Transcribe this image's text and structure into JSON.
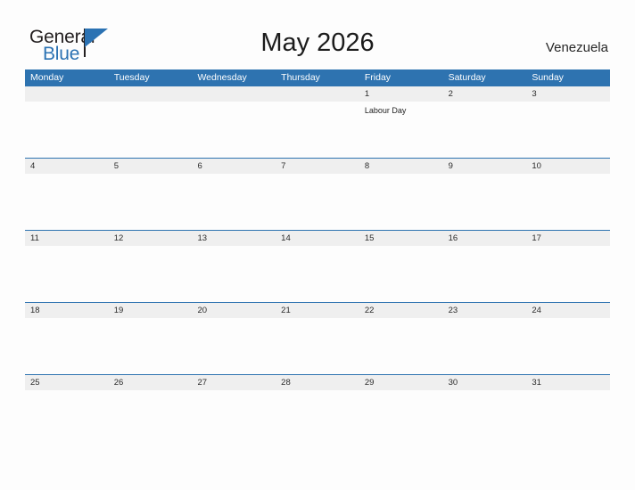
{
  "brand": {
    "name_part1": "General",
    "name_part2": "Blue",
    "flag_icon": "blue-triangle-flag-icon",
    "primary_color": "#2b72b3",
    "text_color": "#231f20"
  },
  "header": {
    "title": "May 2026",
    "country": "Venezuela"
  },
  "colors": {
    "header_blue": "#2e73b0",
    "date_band_gray": "#efefef",
    "page_background": "#fdfdfd",
    "text_dark": "#1c1c1c"
  },
  "calendar": {
    "month": "May",
    "year": "2026",
    "week_start": "Monday",
    "day_headers": [
      "Monday",
      "Tuesday",
      "Wednesday",
      "Thursday",
      "Friday",
      "Saturday",
      "Sunday"
    ],
    "weeks": [
      {
        "days": [
          {
            "date": "",
            "event": ""
          },
          {
            "date": "",
            "event": ""
          },
          {
            "date": "",
            "event": ""
          },
          {
            "date": "",
            "event": ""
          },
          {
            "date": "1",
            "event": "Labour Day"
          },
          {
            "date": "2",
            "event": ""
          },
          {
            "date": "3",
            "event": ""
          }
        ]
      },
      {
        "days": [
          {
            "date": "4",
            "event": ""
          },
          {
            "date": "5",
            "event": ""
          },
          {
            "date": "6",
            "event": ""
          },
          {
            "date": "7",
            "event": ""
          },
          {
            "date": "8",
            "event": ""
          },
          {
            "date": "9",
            "event": ""
          },
          {
            "date": "10",
            "event": ""
          }
        ]
      },
      {
        "days": [
          {
            "date": "11",
            "event": ""
          },
          {
            "date": "12",
            "event": ""
          },
          {
            "date": "13",
            "event": ""
          },
          {
            "date": "14",
            "event": ""
          },
          {
            "date": "15",
            "event": ""
          },
          {
            "date": "16",
            "event": ""
          },
          {
            "date": "17",
            "event": ""
          }
        ]
      },
      {
        "days": [
          {
            "date": "18",
            "event": ""
          },
          {
            "date": "19",
            "event": ""
          },
          {
            "date": "20",
            "event": ""
          },
          {
            "date": "21",
            "event": ""
          },
          {
            "date": "22",
            "event": ""
          },
          {
            "date": "23",
            "event": ""
          },
          {
            "date": "24",
            "event": ""
          }
        ]
      },
      {
        "days": [
          {
            "date": "25",
            "event": ""
          },
          {
            "date": "26",
            "event": ""
          },
          {
            "date": "27",
            "event": ""
          },
          {
            "date": "28",
            "event": ""
          },
          {
            "date": "29",
            "event": ""
          },
          {
            "date": "30",
            "event": ""
          },
          {
            "date": "31",
            "event": ""
          }
        ]
      }
    ]
  }
}
